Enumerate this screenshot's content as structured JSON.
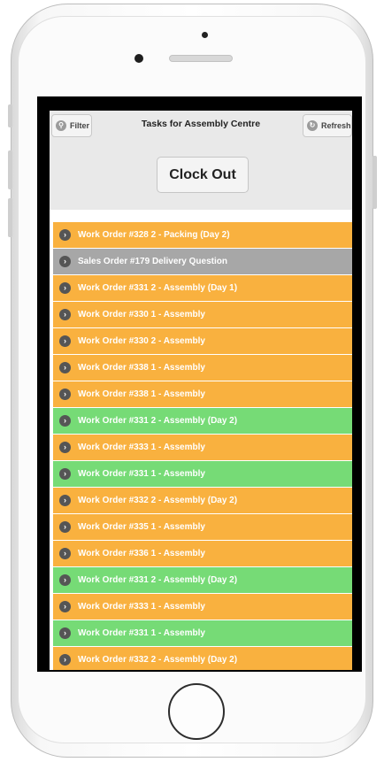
{
  "header": {
    "filter_label": "Filter",
    "title": "Tasks for Assembly Centre",
    "refresh_label": "Refresh",
    "clock_out_label": "Clock Out"
  },
  "icons": {
    "filter": "search-icon",
    "refresh": "refresh-icon",
    "row": "chevron-right-icon"
  },
  "status_colors": {
    "orange": "#f9b13f",
    "gray": "#a7a7a7",
    "green": "#76db76"
  },
  "tasks": [
    {
      "label": "Work Order #328 2 - Packing (Day 2)",
      "status": "orange"
    },
    {
      "label": "Sales Order #179 Delivery Question",
      "status": "gray"
    },
    {
      "label": "Work Order #331 2 - Assembly (Day 1)",
      "status": "orange"
    },
    {
      "label": "Work Order #330 1 - Assembly",
      "status": "orange"
    },
    {
      "label": "Work Order #330 2 - Assembly",
      "status": "orange"
    },
    {
      "label": "Work Order #338 1 - Assembly",
      "status": "orange"
    },
    {
      "label": "Work Order #338 1 - Assembly",
      "status": "orange"
    },
    {
      "label": "Work Order #331 2 - Assembly (Day 2)",
      "status": "green"
    },
    {
      "label": "Work Order #333 1 - Assembly",
      "status": "orange"
    },
    {
      "label": "Work Order #331 1 - Assembly",
      "status": "green"
    },
    {
      "label": "Work Order #332 2 - Assembly (Day 2)",
      "status": "orange"
    },
    {
      "label": "Work Order #335 1 - Assembly",
      "status": "orange"
    },
    {
      "label": "Work Order #336 1 - Assembly",
      "status": "orange"
    },
    {
      "label": "Work Order #331 2 - Assembly (Day 2)",
      "status": "green"
    },
    {
      "label": "Work Order #333 1 - Assembly",
      "status": "orange"
    },
    {
      "label": "Work Order #331 1 - Assembly",
      "status": "green"
    },
    {
      "label": "Work Order #332 2 - Assembly (Day 2)",
      "status": "orange"
    }
  ]
}
